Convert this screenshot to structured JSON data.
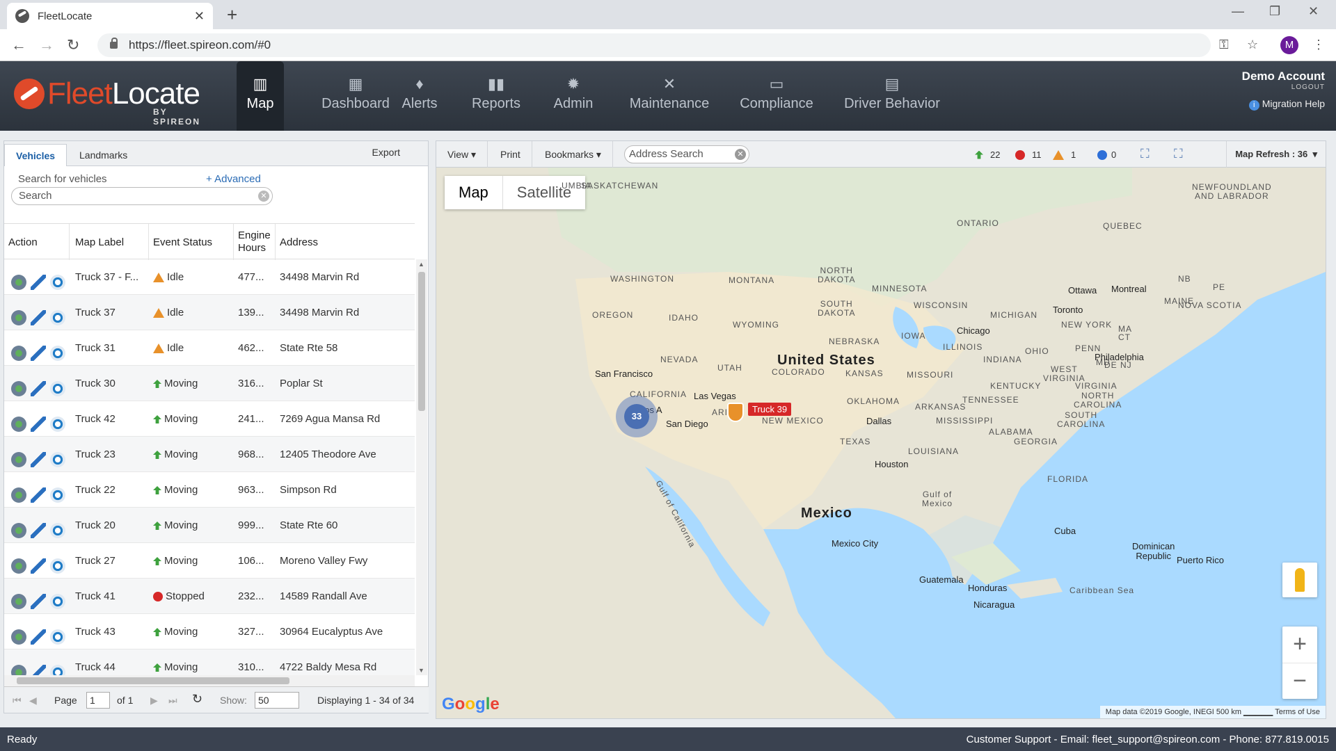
{
  "browser": {
    "tab_title": "FleetLocate",
    "tab_close": "✕",
    "new_tab": "+",
    "url": "https://fleet.spireon.com/#0",
    "profile_initial": "M"
  },
  "header": {
    "logo_fleet": "Fleet",
    "logo_locate": "Locate",
    "logo_by": "BY SPIREON",
    "nav": [
      {
        "label": "Map",
        "icon": "map-icon"
      },
      {
        "label": "Dashboard",
        "icon": "dashboard-icon"
      },
      {
        "label": "Alerts",
        "icon": "bell-icon"
      },
      {
        "label": "Reports",
        "icon": "bar-chart-icon"
      },
      {
        "label": "Admin",
        "icon": "gear-icon"
      },
      {
        "label": "Maintenance",
        "icon": "tools-icon"
      },
      {
        "label": "Compliance",
        "icon": "id-card-icon"
      },
      {
        "label": "Driver Behavior",
        "icon": "clipboard-icon"
      }
    ],
    "account_name": "Demo Account",
    "logout": "LOGOUT",
    "migration_help": "Migration Help"
  },
  "left": {
    "tabs": [
      "Vehicles",
      "Landmarks"
    ],
    "export": "Export",
    "search_label": "Search for vehicles",
    "advanced": "+ Advanced",
    "search_placeholder": "Search",
    "columns": [
      "Action",
      "Map Label",
      "Event Status",
      "Engine Hours",
      "Address"
    ],
    "rows": [
      {
        "label": "Truck 37 - F...",
        "status": "Idle",
        "status_type": "idle",
        "hours": "477...",
        "address": "34498 Marvin Rd"
      },
      {
        "label": "Truck 37",
        "status": "Idle",
        "status_type": "idle",
        "hours": "139...",
        "address": "34498 Marvin Rd"
      },
      {
        "label": "Truck 31",
        "status": "Idle",
        "status_type": "idle",
        "hours": "462...",
        "address": "State Rte 58"
      },
      {
        "label": "Truck 30",
        "status": "Moving",
        "status_type": "moving",
        "hours": "316...",
        "address": "Poplar St"
      },
      {
        "label": "Truck 42",
        "status": "Moving",
        "status_type": "moving",
        "hours": "241...",
        "address": "7269 Agua Mansa Rd"
      },
      {
        "label": "Truck 23",
        "status": "Moving",
        "status_type": "moving",
        "hours": "968...",
        "address": "12405 Theodore Ave"
      },
      {
        "label": "Truck 22",
        "status": "Moving",
        "status_type": "moving",
        "hours": "963...",
        "address": "Simpson Rd"
      },
      {
        "label": "Truck 20",
        "status": "Moving",
        "status_type": "moving",
        "hours": "999...",
        "address": "State Rte 60"
      },
      {
        "label": "Truck 27",
        "status": "Moving",
        "status_type": "moving",
        "hours": "106...",
        "address": "Moreno Valley Fwy"
      },
      {
        "label": "Truck 41",
        "status": "Stopped",
        "status_type": "stopped",
        "hours": "232...",
        "address": "14589 Randall Ave"
      },
      {
        "label": "Truck 43",
        "status": "Moving",
        "status_type": "moving",
        "hours": "327...",
        "address": "30964 Eucalyptus Ave"
      },
      {
        "label": "Truck 44",
        "status": "Moving",
        "status_type": "moving",
        "hours": "310...",
        "address": "4722 Baldy Mesa Rd"
      }
    ],
    "pager": {
      "page_label": "Page",
      "page_value": "1",
      "of": "of 1",
      "show_label": "Show:",
      "show_value": "50",
      "displaying": "Displaying 1 - 34 of 34"
    }
  },
  "map": {
    "toolbar": {
      "view": "View",
      "print": "Print",
      "bookmarks": "Bookmarks",
      "address_placeholder": "Address Search",
      "refresh": "Map Refresh : 36"
    },
    "counts": {
      "moving": "22",
      "stopped": "11",
      "idle": "1",
      "other": "0"
    },
    "types": [
      "Map",
      "Satellite"
    ],
    "cluster_count": "33",
    "truck_label": "Truck 39",
    "google": "Google",
    "footer": "Map data ©2019 Google, INEGI    500 km ▁▁▁▁▁    Terms of Use",
    "labels": {
      "saskatchewan": "SASKATCHEWAN",
      "columbia": "UMBIA",
      "newfoundland": "NEWFOUNDLAND\nAND LABRADOR",
      "ontario": "ONTARIO",
      "quebec": "QUEBEC",
      "washington": "WASHINGTON",
      "montana": "MONTANA",
      "north_dakota": "NORTH\nDAKOTA",
      "minnesota": "MINNESOTA",
      "oregon": "OREGON",
      "idaho": "IDAHO",
      "south_dakota": "SOUTH\nDAKOTA",
      "wyoming": "WYOMING",
      "wisconsin": "WISCONSIN",
      "michigan": "MICHIGAN",
      "nebraska": "NEBRASKA",
      "iowa": "IOWA",
      "nevada": "NEVADA",
      "utah": "UTAH",
      "colorado": "COLORADO",
      "kansas": "KANSAS",
      "missouri": "MISSOURI",
      "illinois": "ILLINOIS",
      "indiana": "INDIANA",
      "ohio": "OHIO",
      "penn": "PENN",
      "new_york": "NEW YORK",
      "maine": "MAINE",
      "nova_scotia": "NOVA SCOTIA",
      "nb": "NB",
      "pe": "PE",
      "ma": "MA",
      "ct": "CT",
      "california": "CALIFORNIA",
      "arizona": "ARI",
      "new_mexico": "NEW MEXICO",
      "oklahoma": "OKLAHOMA",
      "arkansas": "ARKANSAS",
      "tennessee": "TENNESSEE",
      "kentucky": "KENTUCKY",
      "west_virginia": "WEST\nVIRGINIA",
      "virginia": "VIRGINIA",
      "md": "MD",
      "de": "DE NJ",
      "north_carolina": "NORTH\nCAROLINA",
      "south_carolina": "SOUTH\nCAROLINA",
      "mississippi": "MISSISSIPPI",
      "alabama": "ALABAMA",
      "georgia": "GEORGIA",
      "texas": "TEXAS",
      "louisiana": "LOUISIANA",
      "florida": "FLORIDA",
      "united_states": "United States",
      "mexico": "Mexico",
      "gulf_mexico": "Gulf of\nMexico",
      "gulf_california": "Gulf of California",
      "cuba": "Cuba",
      "dominican": "Dominican\nRepublic",
      "puerto_rico": "Puerto Rico",
      "guatemala": "Guatemala",
      "honduras": "Honduras",
      "nicaragua": "Nicaragua",
      "caribbean": "Caribbean Sea",
      "ottawa": "Ottawa",
      "montreal": "Montreal",
      "toronto": "Toronto",
      "chicago": "Chicago",
      "philadelphia": "Philadelphia",
      "san_francisco": "San Francisco",
      "las_vegas": "Las Vegas",
      "los_angeles": "Los A",
      "san_diego": "San Diego",
      "dallas": "Dallas",
      "houston": "Houston",
      "mexico_city": "Mexico City"
    }
  },
  "status": {
    "left": "Ready",
    "right": "Customer Support - Email: fleet_support@spireon.com - Phone: 877.819.0015"
  }
}
